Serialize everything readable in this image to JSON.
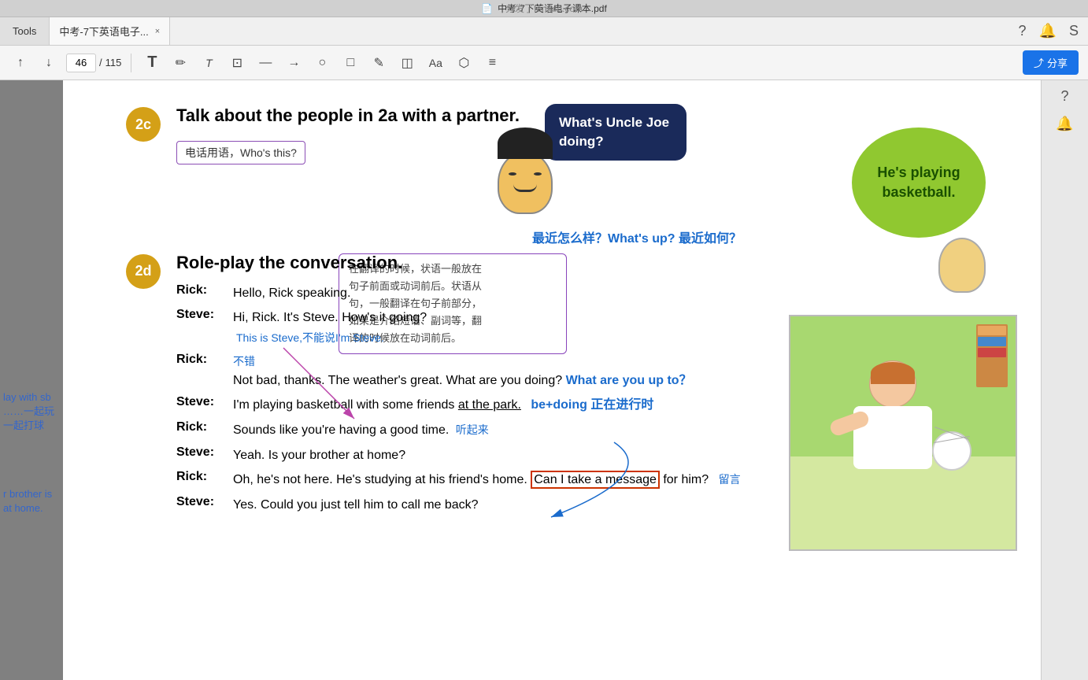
{
  "titleBar": {
    "watermark": "分发了fenfale.com",
    "title": "中考-7下英语电子课本.pdf"
  },
  "tabBar": {
    "toolsLabel": "Tools",
    "docTabLabel": "中考-7下英语电子...",
    "closeLabel": "×"
  },
  "toolbar": {
    "pageNum": "46",
    "totalPages": "115",
    "separator": "/",
    "shareLabel": "分享"
  },
  "leftSidebar": {
    "note1": "lay with sb",
    "note2": "……一起玩",
    "note3": "一起打球",
    "note4": "r brother is at home."
  },
  "section2c": {
    "badge": "2c",
    "title": "Talk about the people in 2a with a partner."
  },
  "annotationBox1": {
    "text": "电话用语，Who's this?"
  },
  "annotationBox2": {
    "text": "在翻译的时候，状语一般放在\n句子前面或动词前后。状语从\n句，一般翻译在句子前部分，\n如果是介绍短语、副词等，翻\n译的时候放在动词前后。"
  },
  "speechBubble1": {
    "text": "What's Uncle Joe doing?"
  },
  "speechBubble2": {
    "text": "He's playing basketball."
  },
  "section2d": {
    "badge": "2d",
    "title": "Role-play the conversation."
  },
  "conversation": [
    {
      "speaker": "Rick:",
      "speech": "Hello, Rick speaking."
    },
    {
      "speaker": "Steve:",
      "speech": "Hi, Rick. It's Steve. How's it going?",
      "ann1": "This is Steve,不能说I'm Steve."
    },
    {
      "speaker": "Rick:",
      "speech": "Not bad, thanks. The weather's great. What are you doing?",
      "ann_notbad": "不错",
      "ann_whatup": "What are you up to？"
    },
    {
      "speaker": "Steve:",
      "speech": "I'm playing basketball with some friends at the park.",
      "ann_bedoing": "be+doing 正在进行时",
      "underline": "at the park."
    },
    {
      "speaker": "Rick:",
      "speech": "Sounds like you're having a good time.",
      "ann_tingqilai": "听起来"
    },
    {
      "speaker": "Steve:",
      "speech": "Yeah. Is your brother at home?"
    },
    {
      "speaker": "Rick:",
      "speech": "Oh, he's not here. He's studying at his friend's home. Can I take a message for him?",
      "ann_liuyan": "留言",
      "highlight": "Can I take a message"
    },
    {
      "speaker": "Steve:",
      "speech": "Yes. Could you just tell him to call me back?"
    }
  ],
  "largeBlueAnn": {
    "text": "最近怎么样？What's up? 最近如何？"
  },
  "icons": {
    "up_arrow": "↑",
    "down_arrow": "↓",
    "text_t": "T",
    "highlight": "✏",
    "text_small": "T",
    "crop": "⊡",
    "line": "—",
    "arrow_right": "→",
    "circle": "○",
    "square": "□",
    "pencil": "✎",
    "eraser": "◫",
    "font_aa": "Aa",
    "fill": "⬡",
    "menu": "≡",
    "help": "?",
    "bell": "🔔",
    "share": "⤴"
  }
}
